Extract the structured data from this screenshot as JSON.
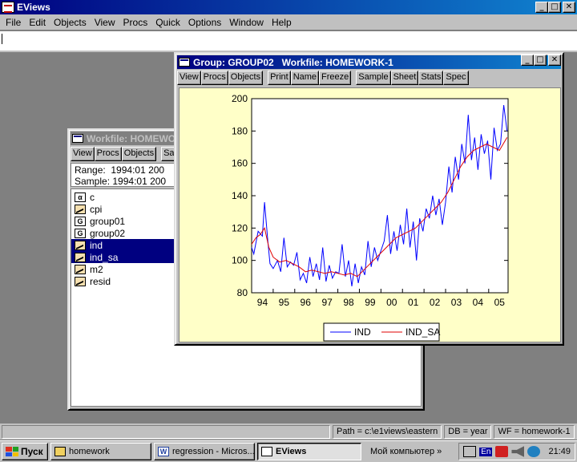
{
  "app": {
    "title": "EViews"
  },
  "menu": [
    "File",
    "Edit",
    "Objects",
    "View",
    "Procs",
    "Quick",
    "Options",
    "Window",
    "Help"
  ],
  "workfile_window": {
    "title": "Workfile: HOMEWO",
    "toolbar": [
      "View",
      "Procs",
      "Objects",
      "Sa"
    ],
    "range_label": "Range:",
    "range_value": "1994:01 200",
    "sample_label": "Sample:",
    "sample_value": "1994:01 200",
    "objects": [
      {
        "icon": "α",
        "name": "c",
        "type": "coef",
        "selected": false
      },
      {
        "icon": "",
        "name": "cpi",
        "type": "series",
        "selected": false
      },
      {
        "icon": "G",
        "name": "group01",
        "type": "group",
        "selected": false
      },
      {
        "icon": "G",
        "name": "group02",
        "type": "group",
        "selected": false
      },
      {
        "icon": "",
        "name": "ind",
        "type": "series",
        "selected": true
      },
      {
        "icon": "",
        "name": "ind_sa",
        "type": "series",
        "selected": true
      },
      {
        "icon": "",
        "name": "m2",
        "type": "series",
        "selected": false
      },
      {
        "icon": "",
        "name": "resid",
        "type": "series",
        "selected": false
      }
    ]
  },
  "group_window": {
    "title": "Group: GROUP02   Workfile: HOMEWORK-1",
    "toolbar_a": [
      "View",
      "Procs",
      "Objects"
    ],
    "toolbar_b": [
      "Print",
      "Name",
      "Freeze"
    ],
    "toolbar_c": [
      "Sample",
      "Sheet",
      "Stats",
      "Spec"
    ]
  },
  "chart_data": {
    "type": "line",
    "title": "",
    "xlabel": "",
    "ylabel": "",
    "ylim": [
      80,
      200
    ],
    "yticks": [
      80,
      100,
      120,
      140,
      160,
      180,
      200
    ],
    "xticks": [
      "94",
      "95",
      "96",
      "97",
      "98",
      "99",
      "00",
      "01",
      "02",
      "03",
      "04",
      "05"
    ],
    "xrange_years": [
      1994,
      2005.9
    ],
    "legend_position": "bottom-center",
    "series": [
      {
        "name": "IND",
        "color": "#0000ff",
        "x": [
          1994.0,
          1994.1,
          1994.3,
          1994.5,
          1994.6,
          1994.75,
          1994.85,
          1995.0,
          1995.2,
          1995.35,
          1995.5,
          1995.65,
          1995.8,
          1995.95,
          1996.1,
          1996.25,
          1996.4,
          1996.55,
          1996.7,
          1996.85,
          1997.0,
          1997.15,
          1997.3,
          1997.45,
          1997.6,
          1997.75,
          1997.9,
          1998.05,
          1998.2,
          1998.35,
          1998.5,
          1998.65,
          1998.8,
          1998.95,
          1999.1,
          1999.25,
          1999.4,
          1999.55,
          1999.7,
          1999.85,
          2000.0,
          2000.15,
          2000.3,
          2000.45,
          2000.6,
          2000.75,
          2000.9,
          2001.05,
          2001.2,
          2001.35,
          2001.5,
          2001.65,
          2001.8,
          2001.95,
          2002.1,
          2002.25,
          2002.4,
          2002.55,
          2002.7,
          2002.85,
          2003.0,
          2003.15,
          2003.3,
          2003.45,
          2003.6,
          2003.75,
          2003.9,
          2004.05,
          2004.2,
          2004.35,
          2004.5,
          2004.65,
          2004.8,
          2004.95,
          2005.1,
          2005.25,
          2005.4,
          2005.55,
          2005.7,
          2005.85
        ],
        "values": [
          108,
          104,
          118,
          115,
          136,
          112,
          98,
          95,
          100,
          93,
          114,
          96,
          99,
          97,
          105,
          88,
          92,
          86,
          102,
          90,
          98,
          88,
          108,
          87,
          97,
          89,
          93,
          92,
          110,
          90,
          100,
          84,
          98,
          86,
          96,
          91,
          112,
          96,
          108,
          100,
          106,
          112,
          128,
          104,
          118,
          106,
          122,
          110,
          132,
          108,
          124,
          100,
          126,
          118,
          132,
          126,
          140,
          128,
          138,
          122,
          136,
          158,
          142,
          164,
          150,
          172,
          160,
          190,
          162,
          176,
          156,
          178,
          166,
          174,
          150,
          182,
          168,
          172,
          196,
          180
        ]
      },
      {
        "name": "IND_SA",
        "color": "#e00000",
        "x": [
          1994.0,
          1994.2,
          1994.4,
          1994.6,
          1994.8,
          1995.0,
          1995.3,
          1995.6,
          1995.9,
          1996.2,
          1996.5,
          1996.8,
          1997.1,
          1997.4,
          1997.7,
          1998.0,
          1998.3,
          1998.6,
          1998.9,
          1999.2,
          1999.5,
          1999.8,
          2000.1,
          2000.4,
          2000.7,
          2001.0,
          2001.3,
          2001.6,
          2001.9,
          2002.2,
          2002.5,
          2002.8,
          2003.1,
          2003.4,
          2003.7,
          2004.0,
          2004.3,
          2004.6,
          2004.9,
          2005.2,
          2005.5,
          2005.85
        ],
        "values": [
          110,
          114,
          116,
          120,
          108,
          102,
          99,
          100,
          98,
          96,
          93,
          94,
          93,
          92,
          93,
          92,
          91,
          92,
          90,
          94,
          98,
          102,
          106,
          110,
          114,
          116,
          118,
          120,
          124,
          128,
          132,
          136,
          142,
          150,
          158,
          164,
          168,
          170,
          172,
          170,
          168,
          176
        ]
      }
    ]
  },
  "statusbar": {
    "path": "Path = c:\\e1views\\eastern",
    "db": "DB = year",
    "wf": "WF = homework-1"
  },
  "taskbar": {
    "start": "Пуск",
    "tasks": [
      "homework",
      "regression - Micros...",
      "EViews"
    ],
    "mycomputer": "Мой компьютер",
    "chevron": "»",
    "lang": "En",
    "clock": "21:49"
  }
}
